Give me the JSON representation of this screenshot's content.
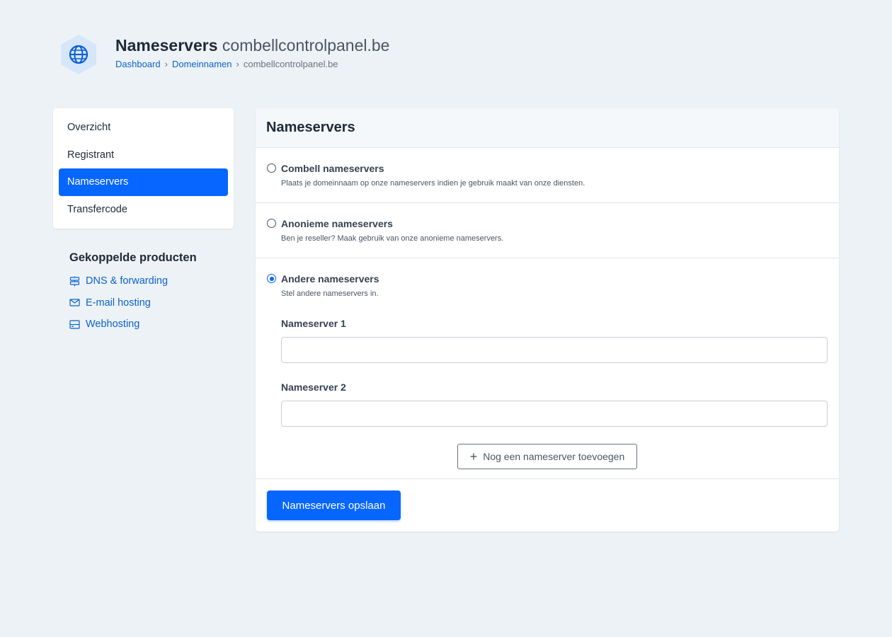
{
  "header": {
    "title_bold": "Nameservers",
    "title_domain": "combellcontrolpanel.be",
    "breadcrumb": [
      "Dashboard",
      "Domeinnamen",
      "combellcontrolpanel.be"
    ],
    "logo_icon": "globe-icon",
    "logo_color": "#dbeafe"
  },
  "sidebar": {
    "items": [
      {
        "label": "Overzicht",
        "active": false
      },
      {
        "label": "Registrant",
        "active": false
      },
      {
        "label": "Nameservers",
        "active": true
      },
      {
        "label": "Transfercode",
        "active": false
      }
    ],
    "linked_title": "Gekoppelde producten",
    "linked": [
      {
        "label": "DNS & forwarding",
        "icon": "signpost-icon"
      },
      {
        "label": "E-mail hosting",
        "icon": "envelope-icon"
      },
      {
        "label": "Webhosting",
        "icon": "server-icon"
      }
    ]
  },
  "card": {
    "title": "Nameservers",
    "options": [
      {
        "label": "Combell nameservers",
        "desc": "Plaats je domeinnaam op onze nameservers indien je gebruik maakt van onze diensten.",
        "checked": false
      },
      {
        "label": "Anonieme nameservers",
        "desc": "Ben je reseller? Maak gebruik van onze anonieme nameservers.",
        "checked": false
      },
      {
        "label": "Andere nameservers",
        "desc": "Stel andere nameservers in.",
        "checked": true
      }
    ],
    "nameservers": [
      {
        "label": "Nameserver 1",
        "value": ""
      },
      {
        "label": "Nameserver 2",
        "value": ""
      }
    ],
    "add_label": "Nog een nameserver toevoegen",
    "save_label": "Nameservers opslaan"
  },
  "colors": {
    "accent": "#0766ff",
    "link": "#0b63ce",
    "background": "#edf2f6"
  }
}
